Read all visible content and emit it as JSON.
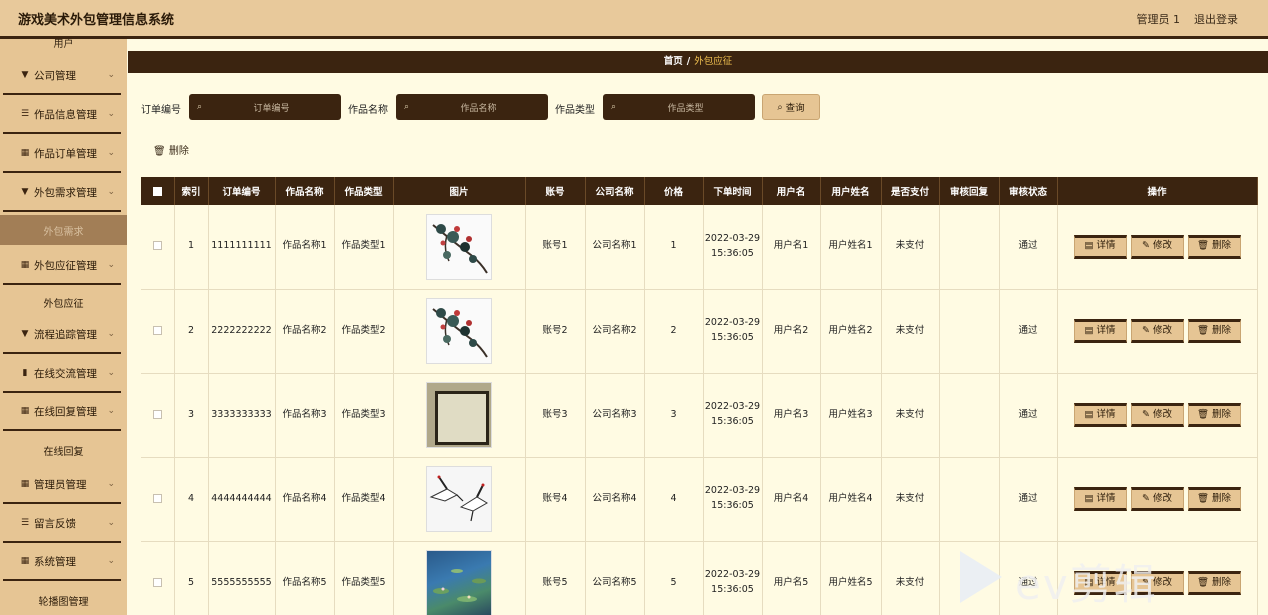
{
  "header": {
    "app_title": "游戏美术外包管理信息系统",
    "user": "管理员 1",
    "logout": "退出登录"
  },
  "sidebar": {
    "top_sub": "用户",
    "menus": [
      {
        "label": "公司管理",
        "icon": "tag-icon"
      },
      {
        "label": "作品信息管理",
        "icon": "list-icon"
      },
      {
        "label": "作品订单管理",
        "icon": "grid-icon"
      },
      {
        "label": "外包需求管理",
        "icon": "tag-icon"
      },
      {
        "label": "外包应征管理",
        "icon": "apps-icon"
      },
      {
        "label": "流程追踪管理",
        "icon": "tag-icon"
      },
      {
        "label": "在线交流管理",
        "icon": "bar-chart-icon"
      },
      {
        "label": "在线回复管理",
        "icon": "apps-icon"
      },
      {
        "label": "管理员管理",
        "icon": "apps-icon"
      },
      {
        "label": "留言反馈",
        "icon": "list-icon"
      },
      {
        "label": "系统管理",
        "icon": "apps-icon"
      }
    ],
    "subs": {
      "waibao_xuqiu": "外包需求",
      "waibao_yingzheng": "外包应征",
      "zaixian_huifu": "在线回复",
      "lunbotu": "轮播图管理"
    }
  },
  "breadcrumb": {
    "home": "首页",
    "sep": "/",
    "current": "外包应征"
  },
  "search": {
    "order_label": "订单编号",
    "order_placeholder": "订单编号",
    "name_label": "作品名称",
    "name_placeholder": "作品名称",
    "type_label": "作品类型",
    "type_placeholder": "作品类型",
    "query": "查询"
  },
  "toolbar": {
    "delete": "删除"
  },
  "table": {
    "headers": [
      "索引",
      "订单编号",
      "作品名称",
      "作品类型",
      "图片",
      "账号",
      "公司名称",
      "价格",
      "下单时间",
      "用户名",
      "用户姓名",
      "是否支付",
      "审核回复",
      "审核状态",
      "操作"
    ],
    "ops": {
      "detail": "详情",
      "edit": "修改",
      "delete": "删除"
    },
    "rows": [
      {
        "idx": "1",
        "order": "1111111111",
        "name": "作品名称1",
        "type": "作品类型1",
        "img": "plum-blossom",
        "account": "账号1",
        "company": "公司名称1",
        "price": "1",
        "time": "2022-03-29 15:36:05",
        "username": "用户名1",
        "realname": "用户姓名1",
        "paid": "未支付",
        "reply": "",
        "status": "通过"
      },
      {
        "idx": "2",
        "order": "2222222222",
        "name": "作品名称2",
        "type": "作品类型2",
        "img": "plum-blossom",
        "account": "账号2",
        "company": "公司名称2",
        "price": "2",
        "time": "2022-03-29 15:36:05",
        "username": "用户名2",
        "realname": "用户姓名2",
        "paid": "未支付",
        "reply": "",
        "status": "通过"
      },
      {
        "idx": "3",
        "order": "3333333333",
        "name": "作品名称3",
        "type": "作品类型3",
        "img": "framed-flower",
        "account": "账号3",
        "company": "公司名称3",
        "price": "3",
        "time": "2022-03-29 15:36:05",
        "username": "用户名3",
        "realname": "用户姓名3",
        "paid": "未支付",
        "reply": "",
        "status": "通过"
      },
      {
        "idx": "4",
        "order": "4444444444",
        "name": "作品名称4",
        "type": "作品类型4",
        "img": "cranes",
        "account": "账号4",
        "company": "公司名称4",
        "price": "4",
        "time": "2022-03-29 15:36:05",
        "username": "用户名4",
        "realname": "用户姓名4",
        "paid": "未支付",
        "reply": "",
        "status": "通过"
      },
      {
        "idx": "5",
        "order": "5555555555",
        "name": "作品名称5",
        "type": "作品类型5",
        "img": "water-lilies",
        "account": "账号5",
        "company": "公司名称5",
        "price": "5",
        "time": "2022-03-29 15:36:05",
        "username": "用户名5",
        "realname": "用户姓名5",
        "paid": "未支付",
        "reply": "",
        "status": "通过"
      }
    ]
  },
  "watermark": {
    "text": "ev剪辑"
  }
}
